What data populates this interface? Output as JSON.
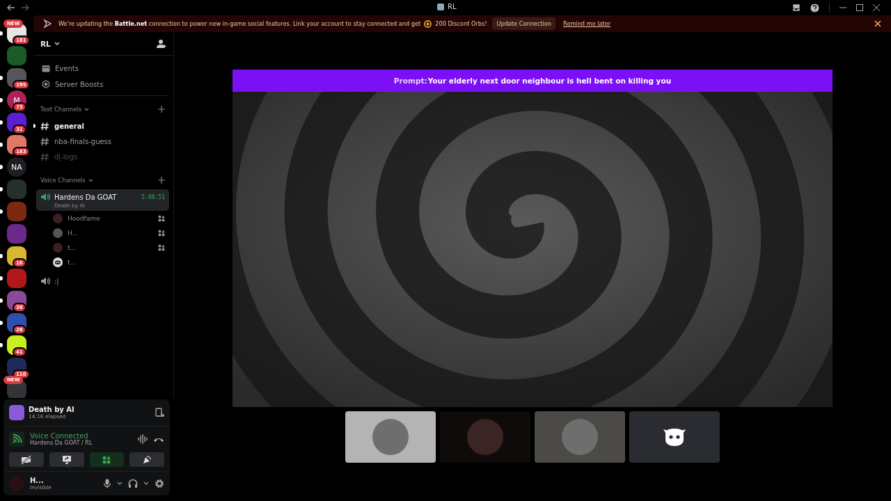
{
  "titlebar": {
    "title": "RL"
  },
  "banner": {
    "text": "We're updating the **Battle.net** connection to power new in-game social features. Link your account to stay connected and get",
    "reward": "200 Discord Orbs!",
    "button": "Update Connection",
    "link": "Remind me later"
  },
  "servers": [
    {
      "kind": "photo",
      "color": "#e6e6e6",
      "badge": "181",
      "new_label": "NEW",
      "unread": true
    },
    {
      "kind": "photo",
      "color": "#1d5a2a",
      "unread": false
    },
    {
      "kind": "photo",
      "color": "#56565a",
      "badge": "195",
      "unread": true
    },
    {
      "kind": "letter",
      "letter": "M",
      "color": "#b0205a",
      "badge": "73",
      "unread": true
    },
    {
      "kind": "photo",
      "color": "#5a1fd0",
      "badge": "31",
      "unread": true
    },
    {
      "kind": "photo",
      "color": "#e07868",
      "badge": "183",
      "unread": true
    },
    {
      "kind": "letter",
      "letter": "NA",
      "color": "#1e1f22",
      "unread": true
    },
    {
      "kind": "photo",
      "color": "#26302a",
      "unread": true
    },
    {
      "kind": "photo",
      "color": "#7a2a10",
      "unread": true
    },
    {
      "kind": "photo",
      "color": "#6a2a8a",
      "unread": false
    },
    {
      "kind": "photo",
      "color": "#d8b830",
      "badge": "16",
      "unread": true
    },
    {
      "kind": "photo",
      "color": "#b01818",
      "unread": true
    },
    {
      "kind": "photo",
      "color": "#8a4a9a",
      "badge": "38",
      "unread": true
    },
    {
      "kind": "photo",
      "color": "#3050b0",
      "badge": "28",
      "unread": true
    },
    {
      "kind": "photo",
      "color": "#c8f020",
      "badge": "41",
      "unread": true
    },
    {
      "kind": "photo",
      "color": "#202a5a",
      "badge": "110",
      "unread": false
    },
    {
      "kind": "photo",
      "color": "#333338",
      "new_label": "NEW",
      "unread": false
    }
  ],
  "sidebar": {
    "server_name": "RL",
    "shortcuts": [
      {
        "kind": "events",
        "label": "Events"
      },
      {
        "kind": "boosts",
        "label": "Server Boosts"
      }
    ],
    "categories": [
      {
        "name": "Text Channels",
        "channels": [
          {
            "kind": "text",
            "name": "general",
            "unread": true,
            "muted": false
          },
          {
            "kind": "text",
            "name": "nba-finals-guess",
            "unread": false,
            "muted": false
          },
          {
            "kind": "text",
            "name": "dj-logs",
            "unread": false,
            "muted": true
          }
        ]
      },
      {
        "name": "Voice Channels",
        "channels": [
          {
            "kind": "voice",
            "name": "Hardens Da GOAT",
            "selected": true,
            "timer": "5:08:51",
            "activity": "Death by AI",
            "members": [
              {
                "kind": "photo",
                "name": "Hoodfame",
                "in_activity": true
              },
              {
                "kind": "photo",
                "name": "H...",
                "in_activity": true
              },
              {
                "kind": "photo",
                "name": "t...",
                "in_activity": true
              },
              {
                "kind": "default",
                "name": "t...",
                "in_activity": false
              }
            ]
          },
          {
            "kind": "voice",
            "name": ":|",
            "selected": false
          }
        ]
      }
    ]
  },
  "panel": {
    "activity": {
      "title": "Death by AI",
      "elapsed": "14:16 elapsed"
    },
    "voice": {
      "status": "Voice Connected",
      "location": "Hardens Da GOAT / RL"
    },
    "actions": [
      {
        "kind": "camera-off",
        "selected": false
      },
      {
        "kind": "screen-share",
        "selected": false
      },
      {
        "kind": "activities",
        "selected": true
      },
      {
        "kind": "soundboard",
        "selected": false
      }
    ],
    "user": {
      "name": "H...",
      "status": "Invisible"
    }
  },
  "stage": {
    "prompt": {
      "label": "Prompt:",
      "text": "Your elderly next door neighbour is hell bent on killing you"
    },
    "tiles": [
      {
        "kind": "photo",
        "color": "#b4b4b4"
      },
      {
        "kind": "photo",
        "color": "#0e0b0a"
      },
      {
        "kind": "photo",
        "color": "#4b4a47"
      },
      {
        "kind": "default",
        "color": "#2b2c31"
      }
    ]
  }
}
